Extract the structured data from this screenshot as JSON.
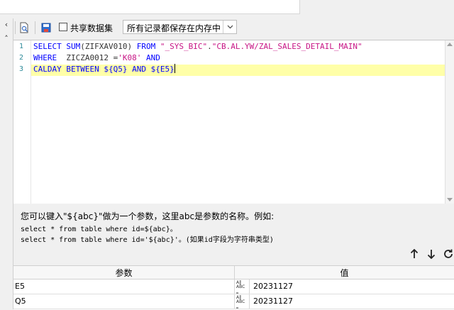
{
  "toolbar": {
    "share_label": "共享数据集",
    "share_checked": false,
    "storage_mode": "所有记录都保存在内存中"
  },
  "editor": {
    "line_numbers": [
      "1",
      "2",
      "3"
    ],
    "lines": [
      [
        {
          "t": "SELECT ",
          "c": "kw"
        },
        {
          "t": "SUM",
          "c": "kw"
        },
        {
          "t": "(ZIFXAV010) ",
          "c": "op"
        },
        {
          "t": "FROM ",
          "c": "kw"
        },
        {
          "t": "\"_SYS_BIC\"",
          "c": "str"
        },
        {
          "t": ".",
          "c": "op"
        },
        {
          "t": "\"CB.AL.YW/ZAL_SALES_DETAIL_MAIN\"",
          "c": "str"
        }
      ],
      [
        {
          "t": "WHERE  ",
          "c": "kw"
        },
        {
          "t": "ZICZA0012 =",
          "c": "op"
        },
        {
          "t": "'K08'",
          "c": "str"
        },
        {
          "t": " ",
          "c": "op"
        },
        {
          "t": "AND",
          "c": "kw"
        }
      ],
      [
        {
          "t": "CALDAY ",
          "c": "kw"
        },
        {
          "t": "BETWEEN ",
          "c": "kw"
        },
        {
          "t": "${Q5} ",
          "c": "kw"
        },
        {
          "t": "AND ",
          "c": "kw"
        },
        {
          "t": "${E5}",
          "c": "kw"
        }
      ]
    ]
  },
  "hint": {
    "title": "您可以键入\"${abc}\"做为一个参数，这里abc是参数的名称。例如:",
    "example1": "select * from table where id=${abc}。",
    "example2": "select * from table where id='${abc}'。(如果id字段为字符串类型)"
  },
  "params": {
    "header_name": "参数",
    "header_value": "值",
    "type_icon_lines": [
      "A‖",
      "ABC",
      "‗"
    ],
    "rows": [
      {
        "name": "E5",
        "value": "20231127"
      },
      {
        "name": "Q5",
        "value": "20231127"
      }
    ]
  },
  "colors": {
    "keyword": "#0000ff",
    "string": "#c71585",
    "current_line": "#ffffa8",
    "line_number": "#2e8b9a"
  }
}
